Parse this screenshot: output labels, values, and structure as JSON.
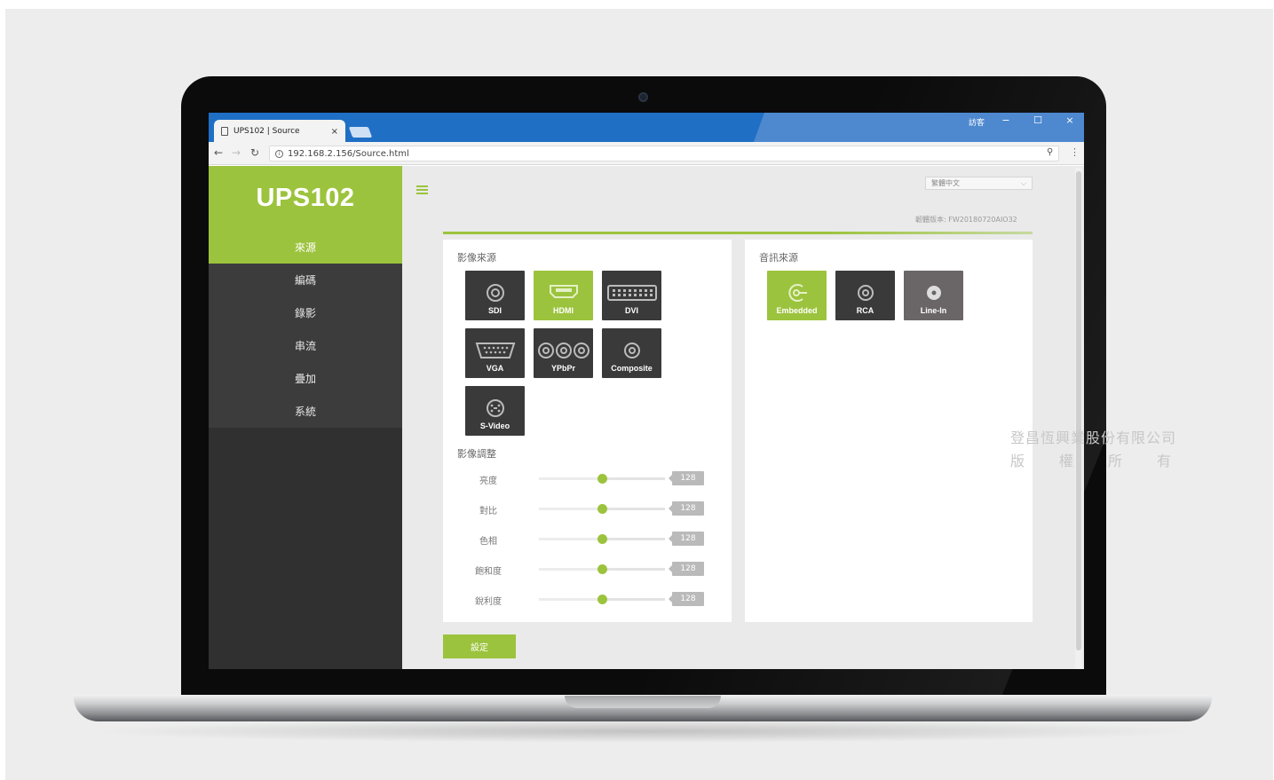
{
  "browser": {
    "tab_title": "UPS102 | Source",
    "tab_close": "×",
    "url": "192.168.2.156/Source.html",
    "window_user": "訪客",
    "window_buttons": [
      "−",
      "☐",
      "×"
    ]
  },
  "brand": "UPS102",
  "sidebar": {
    "items": [
      {
        "label": "來源",
        "active": true
      },
      {
        "label": "編碼",
        "active": false
      },
      {
        "label": "錄影",
        "active": false
      },
      {
        "label": "串流",
        "active": false
      },
      {
        "label": "疊加",
        "active": false
      },
      {
        "label": "系統",
        "active": false
      }
    ]
  },
  "header": {
    "language": "繁體中文",
    "firmware": "韌體版本: FW20180720AIO32"
  },
  "video_source": {
    "title": "影像來源",
    "tiles": [
      {
        "label": "SDI",
        "icon": "sdi-connector-icon",
        "selected": false
      },
      {
        "label": "HDMI",
        "icon": "hdmi-connector-icon",
        "selected": true
      },
      {
        "label": "DVI",
        "icon": "dvi-connector-icon",
        "selected": false
      },
      {
        "label": "VGA",
        "icon": "vga-connector-icon",
        "selected": false
      },
      {
        "label": "YPbPr",
        "icon": "ypbpr-connector-icon",
        "selected": false
      },
      {
        "label": "Composite",
        "icon": "composite-connector-icon",
        "selected": false
      },
      {
        "label": "S-Video",
        "icon": "svideo-connector-icon",
        "selected": false
      }
    ]
  },
  "video_adjust": {
    "title": "影像調整",
    "max": 255,
    "rows": [
      {
        "label": "亮度",
        "value": "128",
        "level": 0.5
      },
      {
        "label": "對比",
        "value": "128",
        "level": 0.5
      },
      {
        "label": "色相",
        "value": "128",
        "level": 0.5
      },
      {
        "label": "飽和度",
        "value": "128",
        "level": 0.5
      },
      {
        "label": "銳利度",
        "value": "128",
        "level": 0.5
      }
    ]
  },
  "audio_source": {
    "title": "音訊來源",
    "tiles": [
      {
        "label": "Embedded",
        "icon": "embedded-audio-icon",
        "selected": true
      },
      {
        "label": "RCA",
        "icon": "rca-connector-icon",
        "selected": false
      },
      {
        "label": "Line-In",
        "icon": "line-in-icon",
        "selected": false
      }
    ]
  },
  "set_button": "設定",
  "watermark": {
    "line1": "登昌恆興業股份有限公司",
    "line2": [
      "版",
      "權",
      "所",
      "有"
    ]
  },
  "colors": {
    "accent": "#9cc33d",
    "sidebar": "#2f302f",
    "titlebar": "#1f6fc5"
  }
}
